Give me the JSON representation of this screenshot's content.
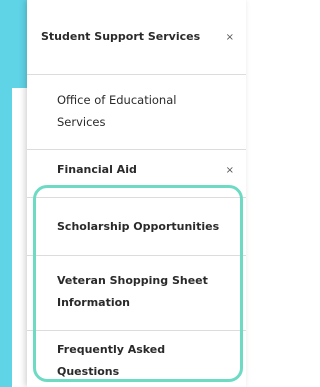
{
  "colors": {
    "accent": "#5fd4e6",
    "highlight": "#6ddbc4"
  },
  "menu": {
    "header": {
      "label": "Student Support Services",
      "close_icon": "×"
    },
    "items": [
      {
        "label": "Office of Educational Services"
      },
      {
        "label": "Financial Aid",
        "close_icon": "×"
      }
    ],
    "subitems": [
      {
        "label": "Scholarship Opportunities"
      },
      {
        "label": "Veteran Shopping Sheet Information"
      },
      {
        "label": "Frequently Asked Questions"
      }
    ]
  }
}
